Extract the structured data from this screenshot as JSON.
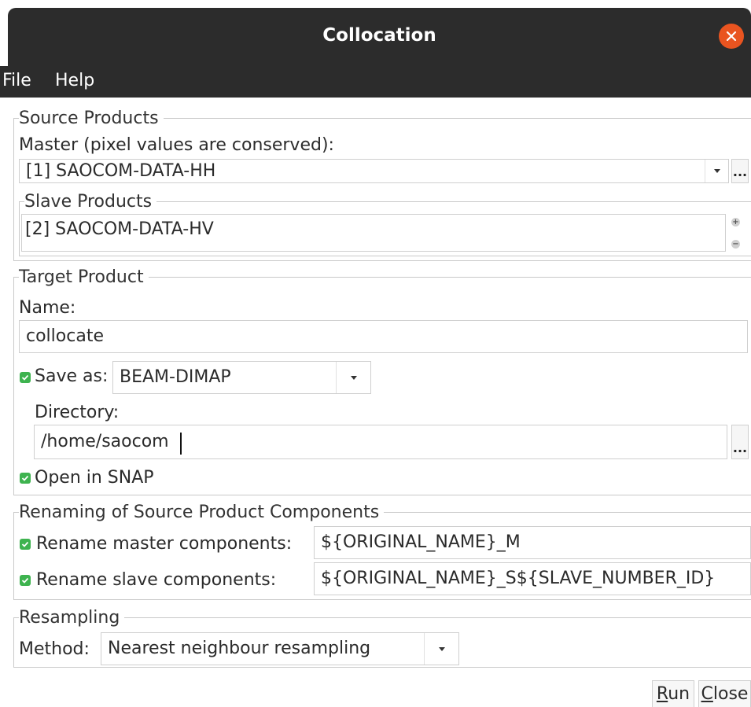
{
  "window": {
    "title": "Collocation"
  },
  "menu": {
    "file": "File",
    "help": "Help"
  },
  "source": {
    "legend": "Source Products",
    "master_label": "Master (pixel values are conserved):",
    "master_value": "[1] SAOCOM-DATA-HH",
    "browse_label": "...",
    "slave_legend": "Slave Products",
    "slave_items": [
      "[2] SAOCOM-DATA-HV"
    ],
    "add_icon": "+",
    "remove_icon": "−"
  },
  "target": {
    "legend": "Target Product",
    "name_label": "Name:",
    "name_value": "collocate",
    "save_as_label": "Save as:",
    "save_as_checked": true,
    "format_value": "BEAM-DIMAP",
    "directory_label": "Directory:",
    "directory_value": "/home/saocom",
    "browse_label": "...",
    "open_label": "Open in SNAP",
    "open_checked": true
  },
  "renaming": {
    "legend": "Renaming of Source Product Components",
    "master_label": "Rename master components:",
    "master_checked": true,
    "master_value": "${ORIGINAL_NAME}_M",
    "slave_label": "Rename slave components:",
    "slave_checked": true,
    "slave_value": "${ORIGINAL_NAME}_S${SLAVE_NUMBER_ID}"
  },
  "resampling": {
    "legend": "Resampling",
    "method_label": "Method:",
    "method_value": "Nearest neighbour resampling"
  },
  "buttons": {
    "run_mnemonic": "R",
    "run_rest": "un",
    "close_mnemonic": "C",
    "close_rest": "lose"
  },
  "colors": {
    "titlebar": "#2c2c2c",
    "close_button": "#e95420",
    "checkbox": "#3eb34f"
  }
}
